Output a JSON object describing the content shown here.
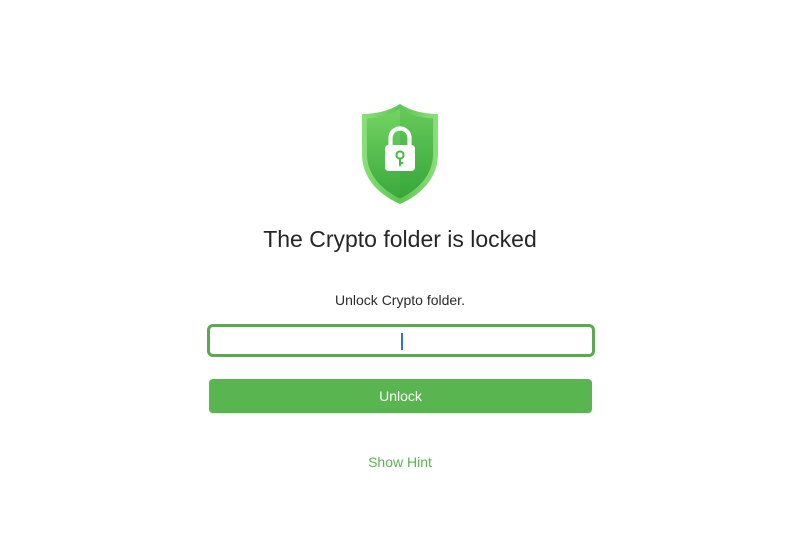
{
  "lock_screen": {
    "shield_icon": "shield-lock-icon",
    "title": "The Crypto folder is locked",
    "subtitle": "Unlock Crypto folder.",
    "password": {
      "value": "",
      "placeholder": ""
    },
    "unlock_label": "Unlock",
    "hint_label": "Show Hint"
  },
  "colors": {
    "accent": "#58b54f",
    "shield_top": "#6fd05f",
    "shield_bottom": "#3fae3f",
    "focus_ring": "#5ca84f",
    "caret": "#2f6fde",
    "title_text": "#262626"
  }
}
